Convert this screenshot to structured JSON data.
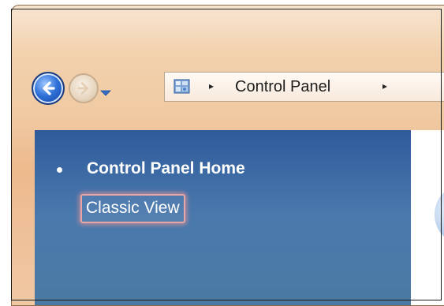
{
  "titlebar": {
    "back_button": "back",
    "forward_button": "forward",
    "history_dropdown": "recent-pages"
  },
  "address_bar": {
    "icon": "control-panel-icon",
    "separator_1": "▸",
    "location": "Control Panel",
    "separator_2": "▸"
  },
  "sidebar": {
    "items": [
      {
        "label": "Control Panel Home",
        "bullet": true,
        "bold": true
      },
      {
        "label": "Classic View",
        "highlighted": true
      }
    ]
  },
  "colors": {
    "titlebar": "#f0c9a1",
    "sidebar": "#3b6aa5",
    "highlight_glow": "#e8a5a5"
  }
}
